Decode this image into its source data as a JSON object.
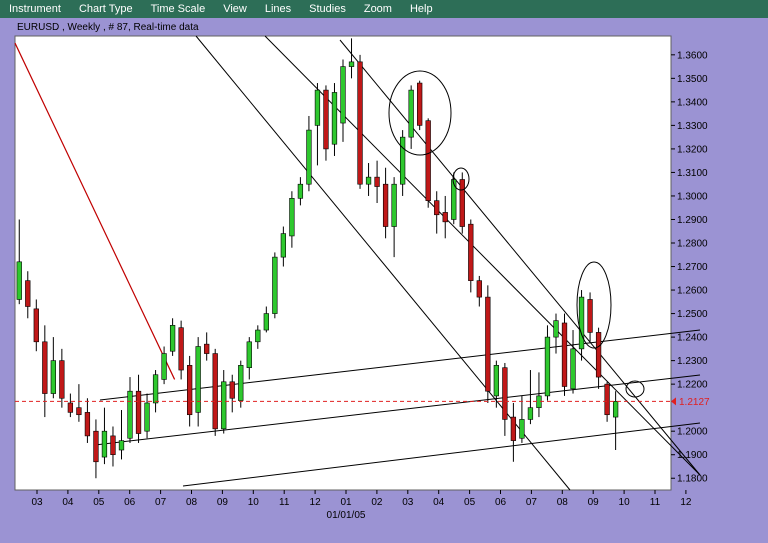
{
  "menu": {
    "items": [
      "Instrument",
      "Chart Type",
      "Time Scale",
      "View",
      "Lines",
      "Studies",
      "Zoom",
      "Help"
    ]
  },
  "chart_title": "EURUSD , Weekly , # 87, Real-time data",
  "chart_data": {
    "type": "candlestick",
    "instrument": "EURUSD",
    "timeframe": "Weekly",
    "ylim": [
      1.175,
      1.368
    ],
    "y_ticks": [
      "1.3600",
      "1.3500",
      "1.3400",
      "1.3300",
      "1.3200",
      "1.3100",
      "1.3000",
      "1.2900",
      "1.2800",
      "1.2700",
      "1.2600",
      "1.2500",
      "1.2400",
      "1.2300",
      "1.2200",
      "1.2000",
      "1.1900",
      "1.1800"
    ],
    "x_ticks": [
      "03",
      "04",
      "05",
      "06",
      "07",
      "08",
      "09",
      "10",
      "11",
      "12",
      "01",
      "02",
      "03",
      "04",
      "05",
      "06",
      "07",
      "08",
      "09",
      "10",
      "11",
      "12"
    ],
    "x_sublabel": "01/01/05",
    "current_price": "1.2127",
    "grid": false,
    "candles": [
      {
        "o": 1.256,
        "h": 1.29,
        "l": 1.254,
        "c": 1.272
      },
      {
        "o": 1.264,
        "h": 1.268,
        "l": 1.248,
        "c": 1.253
      },
      {
        "o": 1.252,
        "h": 1.256,
        "l": 1.234,
        "c": 1.238
      },
      {
        "o": 1.238,
        "h": 1.245,
        "l": 1.206,
        "c": 1.216
      },
      {
        "o": 1.216,
        "h": 1.24,
        "l": 1.214,
        "c": 1.23
      },
      {
        "o": 1.23,
        "h": 1.235,
        "l": 1.21,
        "c": 1.214
      },
      {
        "o": 1.212,
        "h": 1.216,
        "l": 1.206,
        "c": 1.208
      },
      {
        "o": 1.21,
        "h": 1.22,
        "l": 1.204,
        "c": 1.207
      },
      {
        "o": 1.208,
        "h": 1.214,
        "l": 1.195,
        "c": 1.198
      },
      {
        "o": 1.2,
        "h": 1.205,
        "l": 1.18,
        "c": 1.187
      },
      {
        "o": 1.189,
        "h": 1.21,
        "l": 1.186,
        "c": 1.2
      },
      {
        "o": 1.198,
        "h": 1.202,
        "l": 1.185,
        "c": 1.19
      },
      {
        "o": 1.192,
        "h": 1.209,
        "l": 1.188,
        "c": 1.196
      },
      {
        "o": 1.197,
        "h": 1.223,
        "l": 1.195,
        "c": 1.217
      },
      {
        "o": 1.217,
        "h": 1.224,
        "l": 1.195,
        "c": 1.199
      },
      {
        "o": 1.2,
        "h": 1.216,
        "l": 1.197,
        "c": 1.212
      },
      {
        "o": 1.212,
        "h": 1.226,
        "l": 1.208,
        "c": 1.224
      },
      {
        "o": 1.222,
        "h": 1.236,
        "l": 1.22,
        "c": 1.233
      },
      {
        "o": 1.234,
        "h": 1.248,
        "l": 1.232,
        "c": 1.245
      },
      {
        "o": 1.244,
        "h": 1.247,
        "l": 1.222,
        "c": 1.226
      },
      {
        "o": 1.228,
        "h": 1.232,
        "l": 1.202,
        "c": 1.207
      },
      {
        "o": 1.208,
        "h": 1.24,
        "l": 1.202,
        "c": 1.236
      },
      {
        "o": 1.237,
        "h": 1.242,
        "l": 1.23,
        "c": 1.233
      },
      {
        "o": 1.233,
        "h": 1.235,
        "l": 1.198,
        "c": 1.201
      },
      {
        "o": 1.201,
        "h": 1.226,
        "l": 1.199,
        "c": 1.221
      },
      {
        "o": 1.221,
        "h": 1.224,
        "l": 1.208,
        "c": 1.214
      },
      {
        "o": 1.213,
        "h": 1.23,
        "l": 1.21,
        "c": 1.228
      },
      {
        "o": 1.227,
        "h": 1.24,
        "l": 1.222,
        "c": 1.238
      },
      {
        "o": 1.238,
        "h": 1.245,
        "l": 1.235,
        "c": 1.243
      },
      {
        "o": 1.243,
        "h": 1.253,
        "l": 1.242,
        "c": 1.25
      },
      {
        "o": 1.25,
        "h": 1.276,
        "l": 1.248,
        "c": 1.274
      },
      {
        "o": 1.274,
        "h": 1.287,
        "l": 1.27,
        "c": 1.284
      },
      {
        "o": 1.283,
        "h": 1.302,
        "l": 1.278,
        "c": 1.299
      },
      {
        "o": 1.299,
        "h": 1.308,
        "l": 1.296,
        "c": 1.305
      },
      {
        "o": 1.305,
        "h": 1.334,
        "l": 1.302,
        "c": 1.328
      },
      {
        "o": 1.33,
        "h": 1.348,
        "l": 1.313,
        "c": 1.345
      },
      {
        "o": 1.345,
        "h": 1.347,
        "l": 1.315,
        "c": 1.32
      },
      {
        "o": 1.322,
        "h": 1.348,
        "l": 1.317,
        "c": 1.344
      },
      {
        "o": 1.331,
        "h": 1.358,
        "l": 1.323,
        "c": 1.355
      },
      {
        "o": 1.355,
        "h": 1.367,
        "l": 1.35,
        "c": 1.357
      },
      {
        "o": 1.357,
        "h": 1.36,
        "l": 1.303,
        "c": 1.305
      },
      {
        "o": 1.305,
        "h": 1.314,
        "l": 1.3,
        "c": 1.308
      },
      {
        "o": 1.308,
        "h": 1.315,
        "l": 1.297,
        "c": 1.304
      },
      {
        "o": 1.305,
        "h": 1.312,
        "l": 1.282,
        "c": 1.287
      },
      {
        "o": 1.287,
        "h": 1.308,
        "l": 1.274,
        "c": 1.305
      },
      {
        "o": 1.305,
        "h": 1.328,
        "l": 1.3,
        "c": 1.325
      },
      {
        "o": 1.325,
        "h": 1.347,
        "l": 1.32,
        "c": 1.345
      },
      {
        "o": 1.348,
        "h": 1.349,
        "l": 1.328,
        "c": 1.33
      },
      {
        "o": 1.332,
        "h": 1.333,
        "l": 1.295,
        "c": 1.298
      },
      {
        "o": 1.298,
        "h": 1.302,
        "l": 1.284,
        "c": 1.292
      },
      {
        "o": 1.293,
        "h": 1.3,
        "l": 1.282,
        "c": 1.289
      },
      {
        "o": 1.29,
        "h": 1.31,
        "l": 1.288,
        "c": 1.307
      },
      {
        "o": 1.307,
        "h": 1.31,
        "l": 1.284,
        "c": 1.287
      },
      {
        "o": 1.288,
        "h": 1.29,
        "l": 1.259,
        "c": 1.264
      },
      {
        "o": 1.264,
        "h": 1.266,
        "l": 1.253,
        "c": 1.257
      },
      {
        "o": 1.257,
        "h": 1.262,
        "l": 1.212,
        "c": 1.217
      },
      {
        "o": 1.215,
        "h": 1.23,
        "l": 1.21,
        "c": 1.228
      },
      {
        "o": 1.227,
        "h": 1.229,
        "l": 1.198,
        "c": 1.205
      },
      {
        "o": 1.206,
        "h": 1.212,
        "l": 1.187,
        "c": 1.196
      },
      {
        "o": 1.197,
        "h": 1.215,
        "l": 1.195,
        "c": 1.205
      },
      {
        "o": 1.205,
        "h": 1.226,
        "l": 1.203,
        "c": 1.21
      },
      {
        "o": 1.21,
        "h": 1.225,
        "l": 1.206,
        "c": 1.215
      },
      {
        "o": 1.215,
        "h": 1.245,
        "l": 1.213,
        "c": 1.24
      },
      {
        "o": 1.24,
        "h": 1.25,
        "l": 1.233,
        "c": 1.247
      },
      {
        "o": 1.246,
        "h": 1.25,
        "l": 1.215,
        "c": 1.219
      },
      {
        "o": 1.218,
        "h": 1.243,
        "l": 1.216,
        "c": 1.235
      },
      {
        "o": 1.235,
        "h": 1.26,
        "l": 1.23,
        "c": 1.257
      },
      {
        "o": 1.256,
        "h": 1.259,
        "l": 1.238,
        "c": 1.242
      },
      {
        "o": 1.242,
        "h": 1.244,
        "l": 1.218,
        "c": 1.223
      },
      {
        "o": 1.22,
        "h": 1.221,
        "l": 1.204,
        "c": 1.207
      },
      {
        "o": 1.206,
        "h": 1.217,
        "l": 1.192,
        "c": 1.2127
      }
    ],
    "trendlines": [
      {
        "from": [
          0,
          1.365
        ],
        "to": [
          18,
          1.222
        ],
        "color": "#c00000"
      }
    ],
    "annotations": [
      "ellipse",
      "ellipse",
      "ellipse",
      "circle"
    ]
  },
  "colors": {
    "menu_bg": "#2d6e57",
    "frame_bg": "#9b93d3",
    "plot_bg": "#ffffff",
    "up_candle": "#2ec82e",
    "down_candle": "#c01818",
    "current_price_line": "#e02020",
    "trendline_red": "#c00000"
  }
}
